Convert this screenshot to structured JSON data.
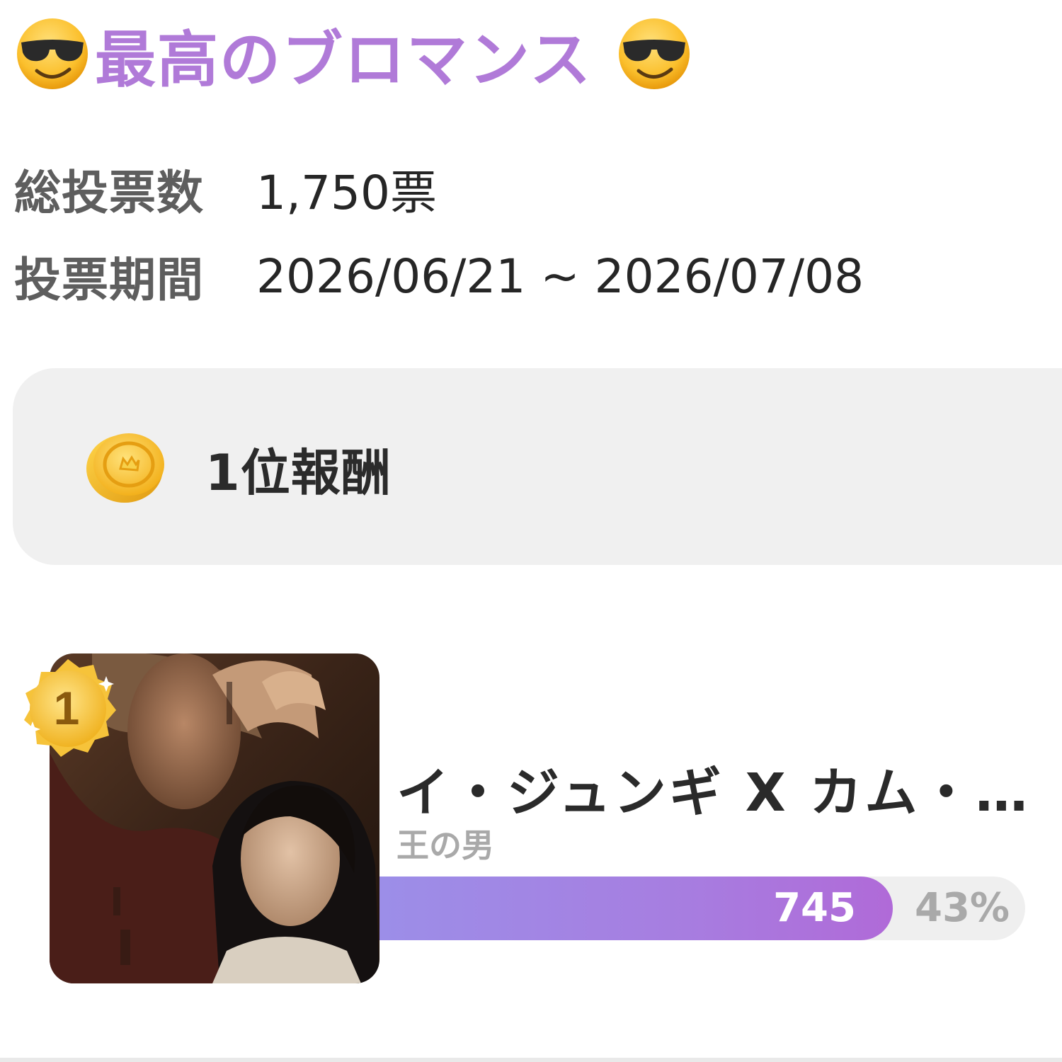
{
  "poll": {
    "title": "最高のブロマンス",
    "title_icon": "smiling-face-with-sunglasses-icon",
    "title_color": "#b07ad8",
    "total_votes_label": "総投票数",
    "total_votes_value": "1,750票",
    "period_label": "投票期間",
    "period_value": "2026/06/21 ~ 2026/07/08"
  },
  "reward": {
    "icon": "gold-coin-icon",
    "label": "1位報酬"
  },
  "candidates": [
    {
      "rank": "1",
      "rank_badge_icon": "gold-medal-icon",
      "name": "イ・ジュンギ X カム・…",
      "subtitle": "王の男",
      "votes": "745",
      "percent_label": "43%",
      "share": 0.43
    }
  ]
}
